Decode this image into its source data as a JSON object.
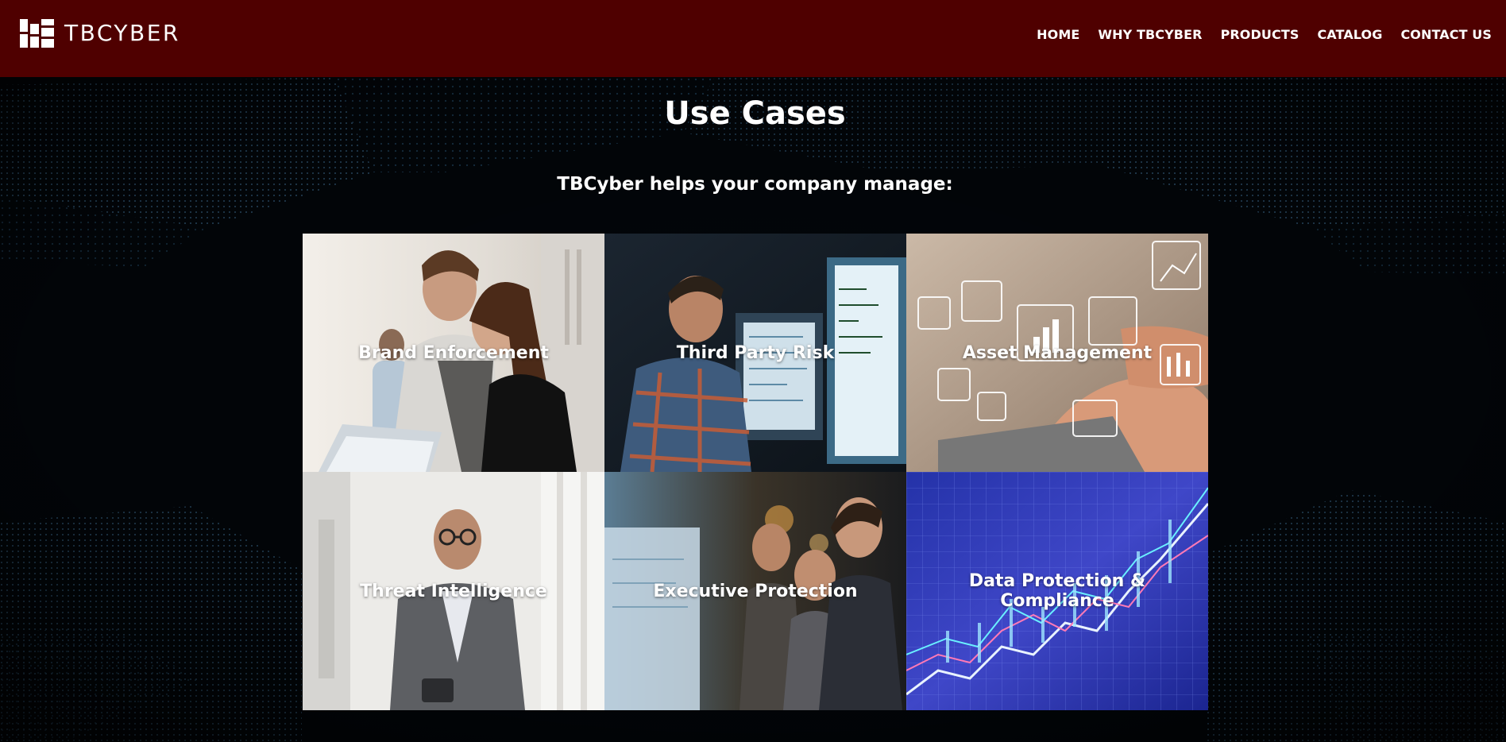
{
  "header": {
    "brand": "TBCYBER",
    "nav": [
      {
        "label": "HOME"
      },
      {
        "label": "WHY TBCYBER"
      },
      {
        "label": "PRODUCTS"
      },
      {
        "label": "CATALOG"
      },
      {
        "label": "CONTACT US"
      }
    ]
  },
  "main": {
    "title": "Use Cases",
    "subtitle": "TBCyber helps your company manage:",
    "cards": [
      {
        "label": "Brand Enforcement"
      },
      {
        "label": "Third Party Risk"
      },
      {
        "label": "Asset Management"
      },
      {
        "label": "Threat Intelligence"
      },
      {
        "label": "Executive Protection"
      },
      {
        "label": "Data Protection & Compliance"
      }
    ]
  },
  "colors": {
    "header_bg": "#4f0000",
    "page_bg": "#03070c",
    "text": "#ffffff"
  }
}
